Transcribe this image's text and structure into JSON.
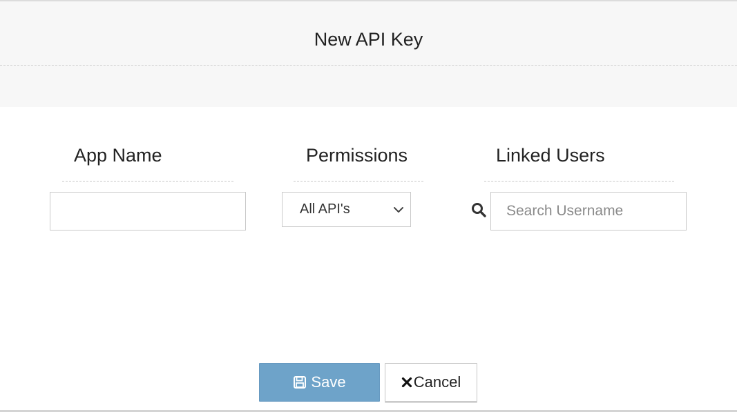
{
  "modal": {
    "title": "New API Key"
  },
  "form": {
    "app_name": {
      "label": "App Name",
      "value": "",
      "placeholder": ""
    },
    "permissions": {
      "label": "Permissions",
      "selected": "All API's"
    },
    "linked_users": {
      "label": "Linked Users",
      "placeholder": "Search Username",
      "icon": "search-icon"
    }
  },
  "actions": {
    "save_label": "Save",
    "save_icon": "floppy-disk-icon",
    "cancel_label": "Cancel",
    "cancel_icon": "close-icon"
  },
  "colors": {
    "header_bg": "#f7f7f7",
    "save_button_bg": "#6ea3c9",
    "cancel_button_bg": "#ffffff"
  }
}
